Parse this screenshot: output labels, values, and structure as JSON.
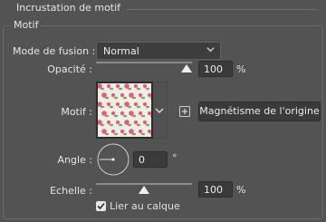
{
  "panel": {
    "title": "Incrustation de motif",
    "group_title": "Motif"
  },
  "blend_mode": {
    "label": "Mode de fusion :",
    "value": "Normal"
  },
  "opacity": {
    "label": "Opacité :",
    "value": "100",
    "unit": "%",
    "level": 1.0
  },
  "pattern": {
    "label": "Motif :"
  },
  "snap_button": {
    "label": "Magnétisme de l'origine"
  },
  "angle": {
    "label": "Angle :",
    "value": "0",
    "unit": "°"
  },
  "scale": {
    "label": "Echelle :",
    "value": "100",
    "unit": "%",
    "level": 0.5
  },
  "link_layer": {
    "label": "Lier au calque",
    "checked": true
  },
  "icons": {
    "chevron": "chevron-down-icon",
    "add": "plus-icon",
    "check": "check-icon",
    "dial": "angle-dial-icon"
  },
  "colors": {
    "background": "#535353",
    "pattern_rose": "#d9607a",
    "pattern_leaf": "#7ea36a"
  }
}
